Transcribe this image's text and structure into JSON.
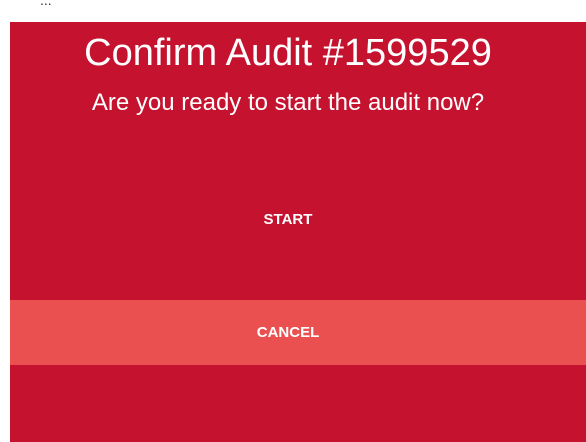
{
  "background_text": "...",
  "dialog": {
    "title": "Confirm Audit #1599529",
    "question": "Are you ready to start the audit now?",
    "start_label": "START",
    "cancel_label": "CANCEL"
  },
  "colors": {
    "dialog_background": "#c4122f",
    "cancel_background": "#eb5050",
    "text": "#ffffff"
  }
}
